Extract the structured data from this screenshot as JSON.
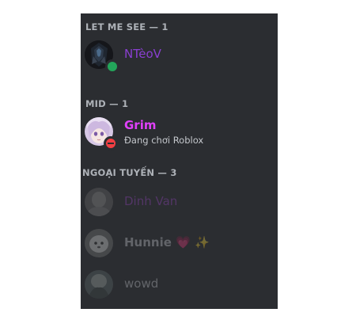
{
  "sections": [
    {
      "header": "LET ME SEE — 1"
    },
    {
      "header": "MID — 1"
    },
    {
      "header": "NGOẠI TUYẾN — 3"
    }
  ],
  "members": {
    "nteov": {
      "name": "NTèoV",
      "color": "#8a3fd1",
      "status": "online"
    },
    "grim": {
      "name": "Grim",
      "color": "#e040fb",
      "status": "dnd",
      "activity": "Đang chơi Roblox"
    },
    "dinh_van": {
      "name": "Dinh Van",
      "color": "#9c46c8"
    },
    "hunnie": {
      "name": "Hunnie",
      "emoji": "💗 ✨",
      "color": "#c9ccd1"
    },
    "wowd": {
      "name": "wowd",
      "color": "#c9ccd1"
    }
  },
  "colors": {
    "panel_bg": "#2b2d31",
    "online": "#23a55a",
    "dnd": "#f23f43"
  }
}
